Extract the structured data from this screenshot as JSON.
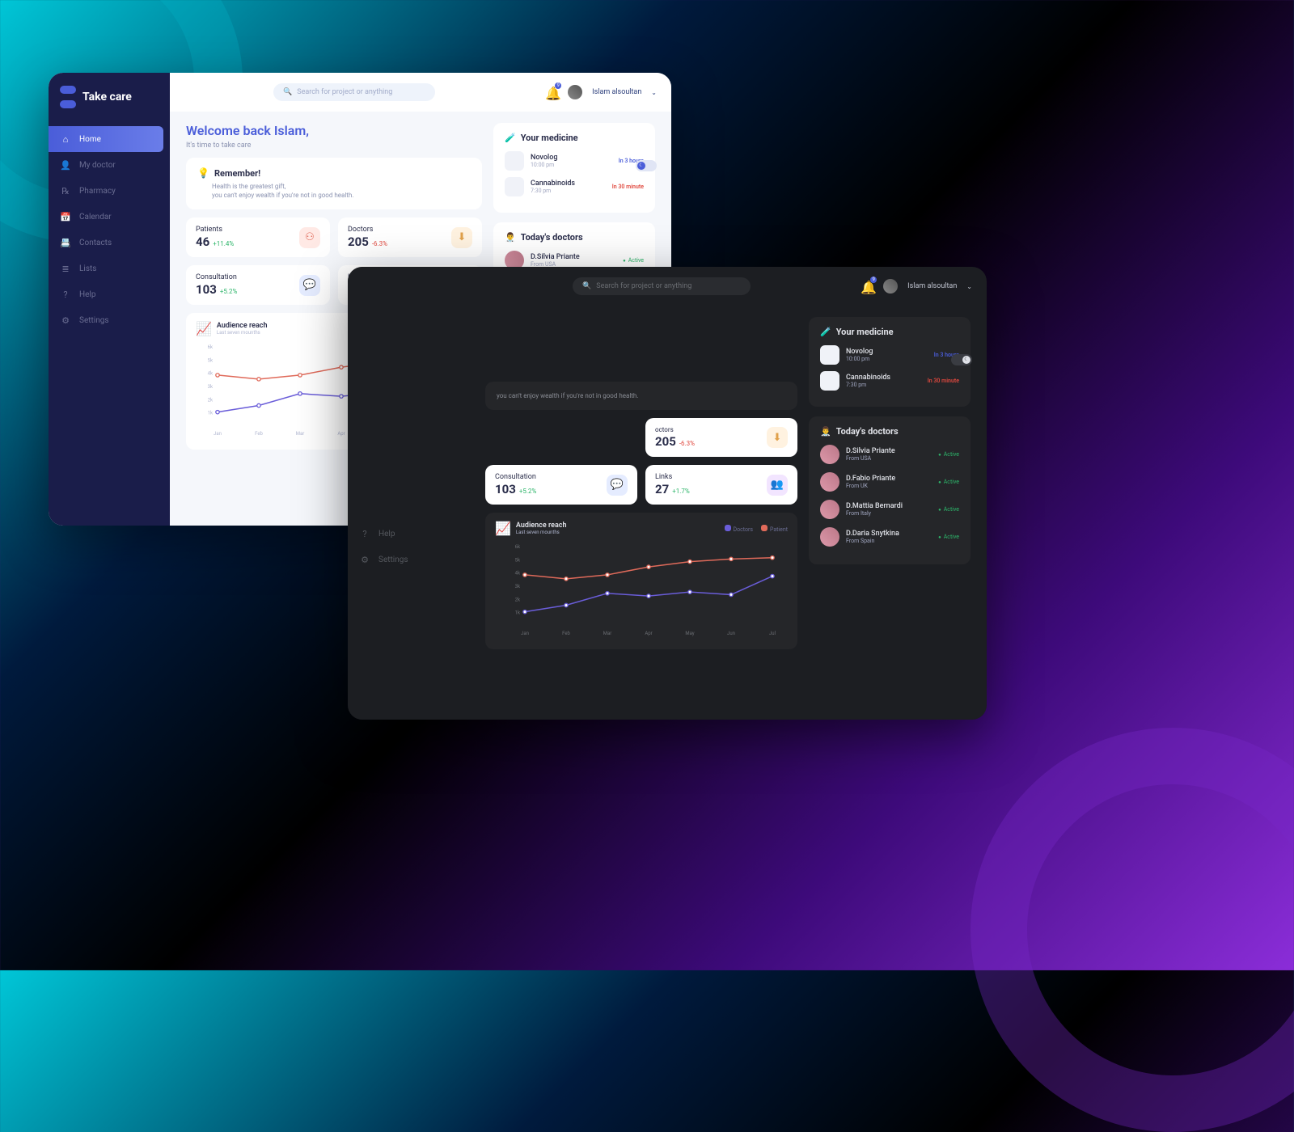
{
  "brand": "Take care",
  "user": {
    "name": "Islam alsoultan",
    "notif_count": 9
  },
  "search_placeholder": "Search for project or anything",
  "welcome": {
    "title": "Welcome back Islam,",
    "subtitle": "It's time to take care"
  },
  "remember": {
    "title": "Remember!",
    "line1": "Health is the greatest gift,",
    "line2": "you can't enjoy wealth if you're not in good health."
  },
  "stats": {
    "patients": {
      "label": "Patients",
      "value": "46",
      "delta": "+11.4%",
      "delta_dir": "pos"
    },
    "doctors": {
      "label": "Doctors",
      "value": "205",
      "delta": "-6.3%",
      "delta_dir": "neg"
    },
    "consultation": {
      "label": "Consultation",
      "value": "103",
      "delta": "+5.2%",
      "delta_dir": "pos"
    },
    "links": {
      "label": "Links",
      "value": "27",
      "delta": "+1.7%",
      "delta_dir": "pos"
    }
  },
  "chart": {
    "title": "Audience reach",
    "subtitle": "Last seven mounths",
    "legend": {
      "doctors": "Doctors",
      "patient": "Patient"
    }
  },
  "chart_data": {
    "type": "line",
    "categories": [
      "Jan",
      "Feb",
      "Mar",
      "Apr",
      "May",
      "Jun",
      "Jul"
    ],
    "series": [
      {
        "name": "Doctors",
        "color": "#6a5dd9",
        "values": [
          1000,
          1500,
          2400,
          2200,
          2500,
          2300,
          3700
        ]
      },
      {
        "name": "Patient",
        "color": "#e06a5a",
        "values": [
          3800,
          3500,
          3800,
          4400,
          4800,
          5000,
          5100
        ]
      }
    ],
    "ylabels": [
      "1k",
      "2k",
      "3k",
      "4k",
      "5k",
      "6k"
    ],
    "ylim": [
      0,
      6000
    ]
  },
  "medicine": {
    "title": "Your medicine",
    "items": [
      {
        "name": "Novolog",
        "time": "10:00 pm",
        "eta": "In 3 hours",
        "eta_class": "eta-blue"
      },
      {
        "name": "Cannabinoids",
        "time": "7:30 pm",
        "eta": "In 30 minute",
        "eta_class": "eta-red"
      }
    ]
  },
  "doctors_today": {
    "title": "Today's doctors",
    "items": [
      {
        "name": "D.Silvia Priante",
        "from": "From USA",
        "status": "Active"
      },
      {
        "name": "D.Fabio Priante",
        "from": "From UK",
        "status": "Active"
      },
      {
        "name": "D.Mattia Bernardi",
        "from": "From Italy",
        "status": "Active"
      },
      {
        "name": "D.Daria Snytkina",
        "from": "From Spain",
        "status": "Active"
      }
    ]
  },
  "sidebar": {
    "items": [
      {
        "label": "Home",
        "icon": "⌂"
      },
      {
        "label": "My doctor",
        "icon": "👤"
      },
      {
        "label": "Pharmacy",
        "icon": "℞"
      },
      {
        "label": "Calendar",
        "icon": "📅"
      },
      {
        "label": "Contacts",
        "icon": "📇"
      },
      {
        "label": "Lists",
        "icon": "≣"
      },
      {
        "label": "Help",
        "icon": "?"
      },
      {
        "label": "Settings",
        "icon": "⚙"
      }
    ]
  }
}
